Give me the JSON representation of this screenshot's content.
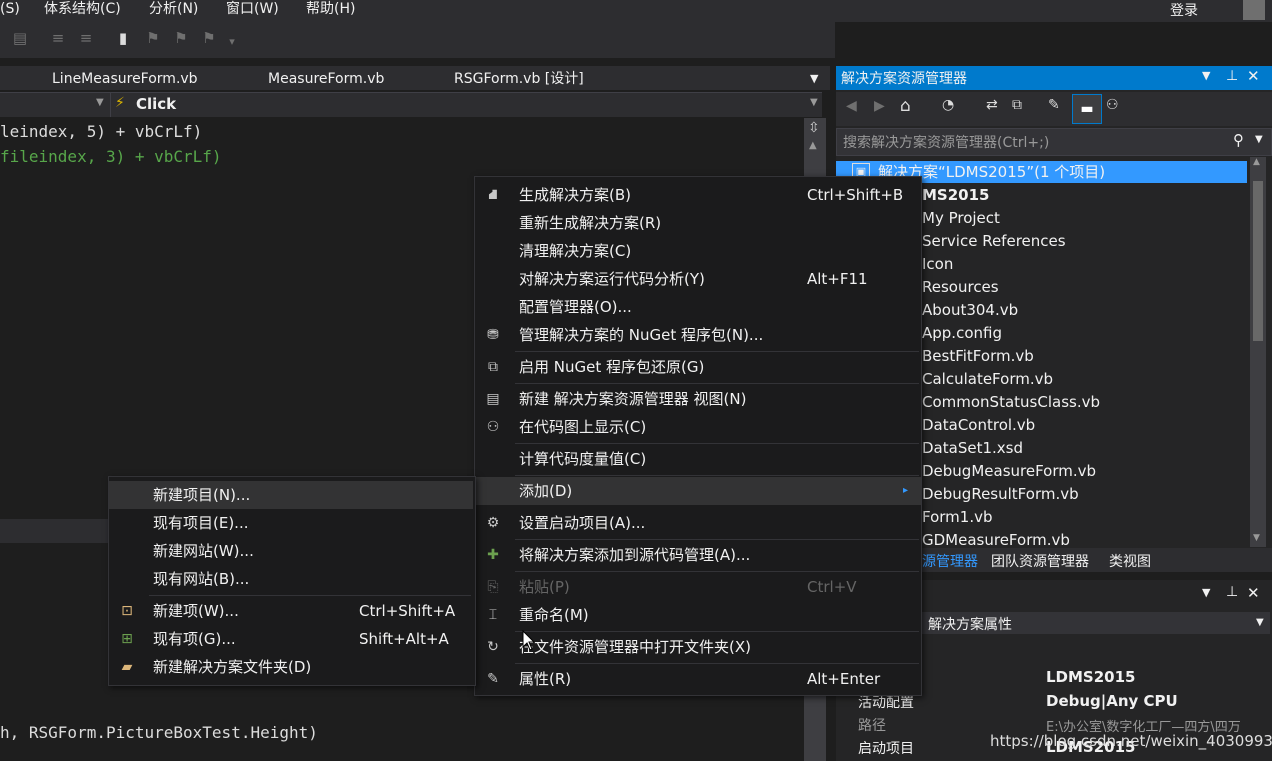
{
  "menubar": {
    "items": [
      "(S)",
      "体系结构(C)",
      "分析(N)",
      "窗口(W)",
      "帮助(H)"
    ],
    "login": "登录"
  },
  "tabs": {
    "items": [
      "LineMeasureForm.vb",
      "MeasureForm.vb",
      "RSGForm.vb [设计]"
    ]
  },
  "navbar": {
    "method": "Click"
  },
  "code": {
    "line1": "leindex, 5) + vbCrLf)",
    "line2": "fileindex, 3) + vbCrLf)",
    "line3": "h, RSGForm.PictureBoxTest.Height)"
  },
  "solution_explorer": {
    "title": "解决方案资源管理器",
    "search_placeholder": "搜索解决方案资源管理器(Ctrl+;)",
    "items": [
      "解决方案“LDMS2015”(1 个项目)",
      "MS2015",
      "My Project",
      "Service References",
      "Icon",
      "Resources",
      "About304.vb",
      "App.config",
      "BestFitForm.vb",
      "CalculateForm.vb",
      "CommonStatusClass.vb",
      "DataControl.vb",
      "DataSet1.xsd",
      "DebugMeasureForm.vb",
      "DebugResultForm.vb",
      "Form1.vb",
      "GDMeasureForm.vb"
    ],
    "bottom_tabs": [
      "源管理器",
      "团队资源管理器",
      "类视图"
    ]
  },
  "properties": {
    "header": "解决方案属性",
    "rows": [
      {
        "key": "",
        "value": "LDMS2015"
      },
      {
        "key": "活动配置",
        "value": "Debug|Any CPU"
      },
      {
        "key": "路径",
        "value": "E:\\办公室\\数字化工厂—四方\\四万"
      },
      {
        "key": "启动项目",
        "value": "LDMS2015"
      }
    ]
  },
  "context_menu": {
    "items": [
      {
        "icon": "build-icon",
        "label": "生成解决方案(B)",
        "shortcut": "Ctrl+Shift+B"
      },
      {
        "icon": "",
        "label": "重新生成解决方案(R)",
        "shortcut": ""
      },
      {
        "icon": "",
        "label": "清理解决方案(C)",
        "shortcut": ""
      },
      {
        "icon": "",
        "label": "对解决方案运行代码分析(Y)",
        "shortcut": "Alt+F11"
      },
      {
        "icon": "",
        "label": "配置管理器(O)...",
        "shortcut": ""
      },
      {
        "icon": "nuget-icon",
        "label": "管理解决方案的 NuGet 程序包(N)...",
        "shortcut": ""
      },
      {
        "icon": "nuget-restore-icon",
        "label": "启用 NuGet 程序包还原(G)",
        "shortcut": ""
      },
      {
        "icon": "new-view-icon",
        "label": "新建 解决方案资源管理器 视图(N)",
        "shortcut": ""
      },
      {
        "icon": "code-map-icon",
        "label": "在代码图上显示(C)",
        "shortcut": ""
      },
      {
        "icon": "",
        "label": "计算代码度量值(C)",
        "shortcut": ""
      },
      {
        "icon": "",
        "label": "添加(D)",
        "shortcut": ""
      },
      {
        "icon": "gear-icon",
        "label": "设置启动项目(A)...",
        "shortcut": ""
      },
      {
        "icon": "source-control-icon",
        "label": "将解决方案添加到源代码管理(A)...",
        "shortcut": ""
      },
      {
        "icon": "paste-icon",
        "label": "粘贴(P)",
        "shortcut": "Ctrl+V"
      },
      {
        "icon": "rename-icon",
        "label": "重命名(M)",
        "shortcut": ""
      },
      {
        "icon": "open-folder-icon",
        "label": "在文件资源管理器中打开文件夹(X)",
        "shortcut": ""
      },
      {
        "icon": "wrench-icon",
        "label": "属性(R)",
        "shortcut": "Alt+Enter"
      }
    ]
  },
  "submenu": {
    "items": [
      {
        "icon": "",
        "label": "新建项目(N)...",
        "shortcut": ""
      },
      {
        "icon": "",
        "label": "现有项目(E)...",
        "shortcut": ""
      },
      {
        "icon": "",
        "label": "新建网站(W)...",
        "shortcut": ""
      },
      {
        "icon": "",
        "label": "现有网站(B)...",
        "shortcut": ""
      },
      {
        "icon": "new-item-icon",
        "label": "新建项(W)...",
        "shortcut": "Ctrl+Shift+A"
      },
      {
        "icon": "existing-item-icon",
        "label": "现有项(G)...",
        "shortcut": "Shift+Alt+A"
      },
      {
        "icon": "folder-icon",
        "label": "新建解决方案文件夹(D)",
        "shortcut": ""
      }
    ]
  },
  "watermark": "https://blog.csdn.net/weixin_40309932"
}
